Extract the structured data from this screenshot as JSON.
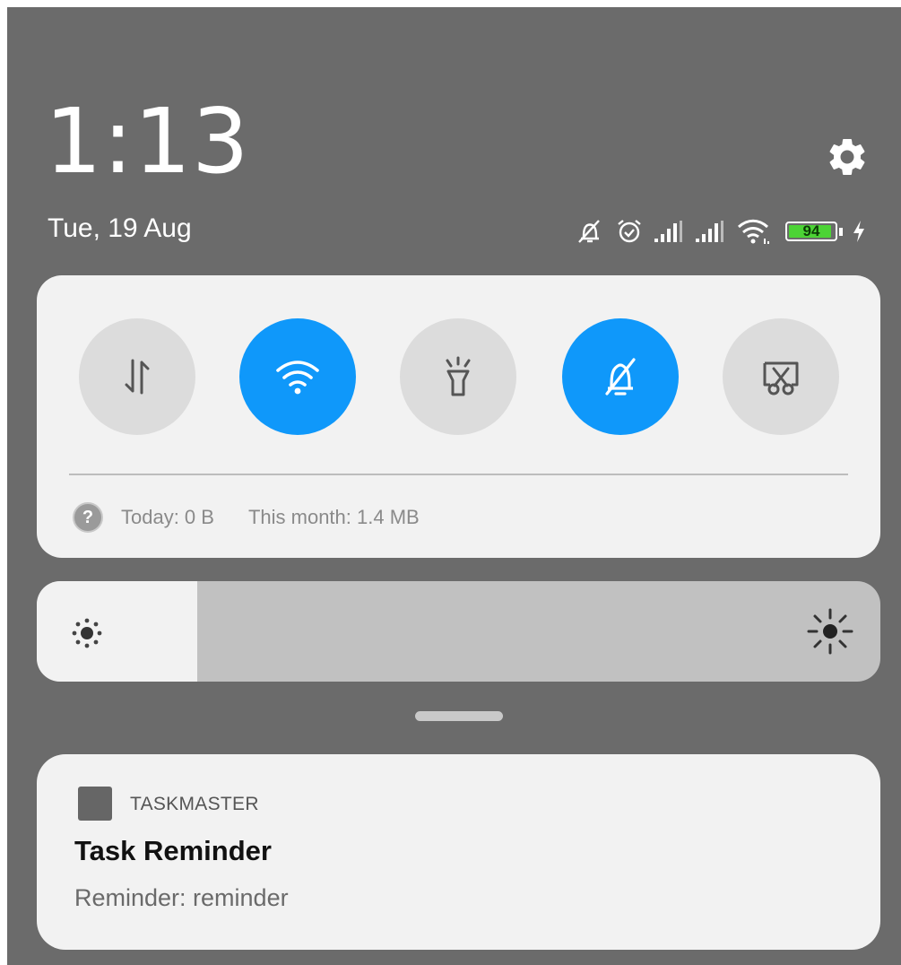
{
  "header": {
    "time": "1:13",
    "date": "Tue, 19 Aug",
    "settings_icon": "gear-icon"
  },
  "status_bar": {
    "icons": [
      "alarm-off-icon",
      "alarm-clock-icon",
      "signal-sim1-icon",
      "signal-sim2-icon",
      "wifi-icon",
      "battery-icon",
      "charging-icon"
    ],
    "battery_level": "94",
    "battery_fraction": 0.94,
    "battery_color": "#4cd335"
  },
  "quick_settings": {
    "toggles": [
      {
        "name": "mobile-data",
        "icon": "data-arrows-icon",
        "state": "off"
      },
      {
        "name": "wifi",
        "icon": "wifi-icon",
        "state": "on"
      },
      {
        "name": "flashlight",
        "icon": "flashlight-icon",
        "state": "off"
      },
      {
        "name": "mute",
        "icon": "bell-off-icon",
        "state": "on"
      },
      {
        "name": "screenshot",
        "icon": "screenshot-scissors-icon",
        "state": "off"
      }
    ],
    "active_color": "#0f98fa",
    "data_usage": {
      "today": "Today: 0 B",
      "month": "This month: 1.4 MB"
    }
  },
  "brightness": {
    "level_fraction": 0.19,
    "low_icon": "brightness-low-icon",
    "high_icon": "brightness-high-icon"
  },
  "notification": {
    "app_name": "TASKMASTER",
    "title": "Task Reminder",
    "body": "Reminder: reminder"
  }
}
